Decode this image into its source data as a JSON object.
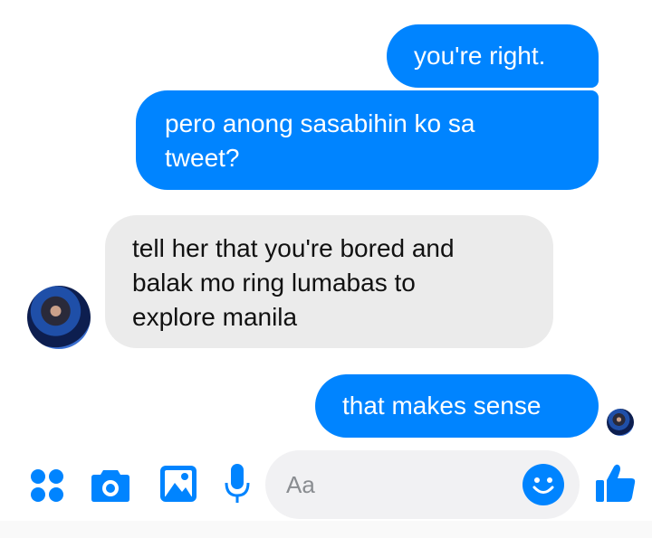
{
  "conversation": {
    "messages": [
      {
        "sender": "me",
        "text": "you're right."
      },
      {
        "sender": "me",
        "text": "pero anong sasabihin ko sa\ntweet?"
      },
      {
        "sender": "contact",
        "text": "tell her that you're bored and\nbalak mo ring lumabas to\nexplore manila"
      },
      {
        "sender": "me",
        "text": "that makes sense"
      }
    ]
  },
  "composer": {
    "placeholder": "Aa",
    "icons": [
      "apps-icon",
      "camera-icon",
      "gallery-icon",
      "mic-icon",
      "emoji-icon",
      "like-icon"
    ]
  },
  "colors": {
    "accent": "#0084ff",
    "received_bubble": "#ebebeb",
    "input_background": "#f1f1f3"
  }
}
